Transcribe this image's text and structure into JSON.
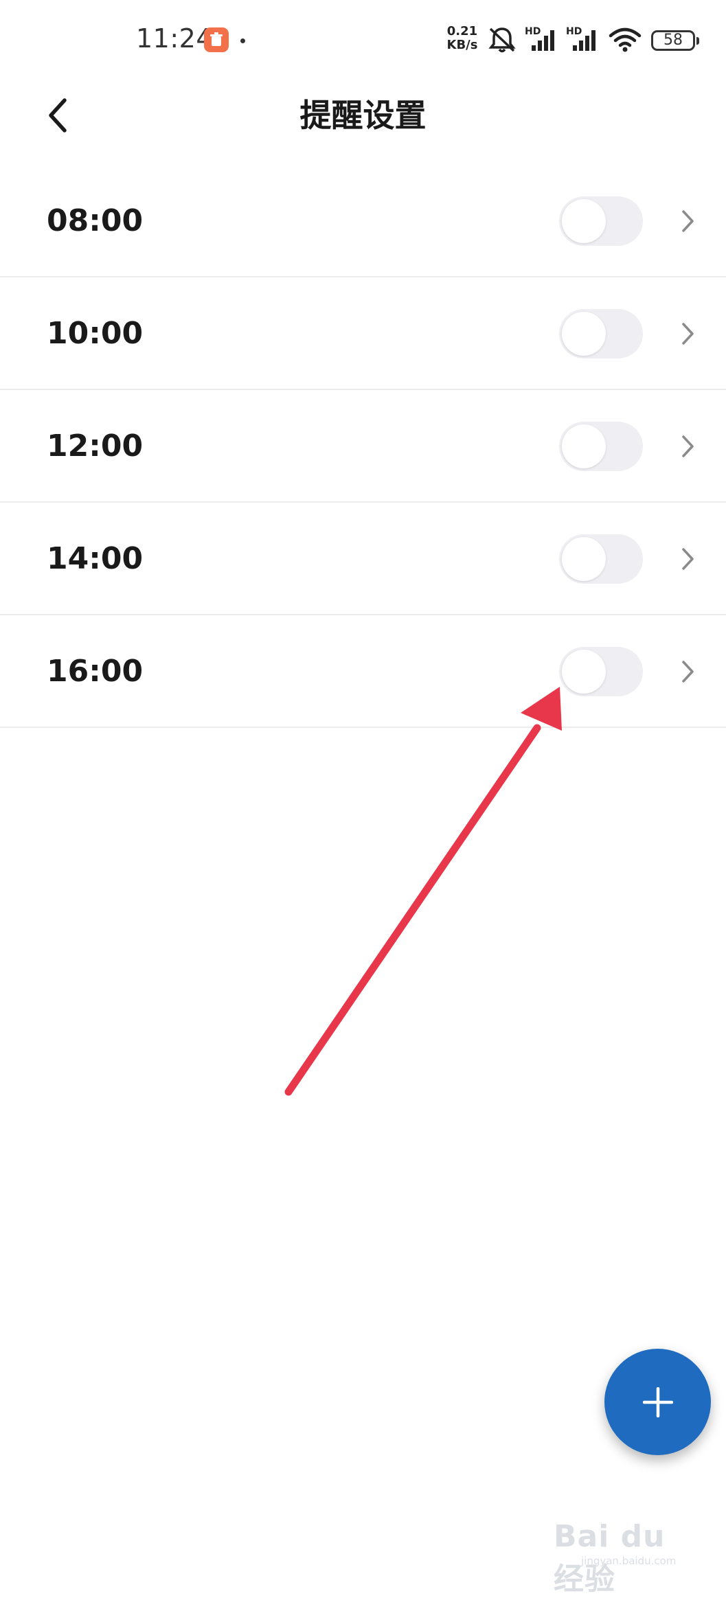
{
  "status_bar": {
    "time": "11:24",
    "net_speed_value": "0.21",
    "net_speed_unit": "KB/s",
    "sim1_label": "HD",
    "sim2_label": "HD",
    "battery": "58",
    "icons": [
      "notification-app-icon",
      "mute-icon",
      "signal-icon",
      "signal-icon",
      "wifi-icon",
      "battery-icon"
    ]
  },
  "header": {
    "title": "提醒设置",
    "back_icon": "chevron-left-icon"
  },
  "reminders": [
    {
      "time": "08:00",
      "enabled": false
    },
    {
      "time": "10:00",
      "enabled": false
    },
    {
      "time": "12:00",
      "enabled": false
    },
    {
      "time": "14:00",
      "enabled": false
    },
    {
      "time": "16:00",
      "enabled": false
    }
  ],
  "fab": {
    "icon": "plus-icon"
  },
  "annotation": {
    "color": "#e8374a"
  },
  "watermark": {
    "brand": "Bai du 经验",
    "site": "jingyan.baidu.com"
  },
  "colors": {
    "accent": "#1e6bbf",
    "toggle_off": "#eeeef3",
    "divider": "#ececec"
  }
}
